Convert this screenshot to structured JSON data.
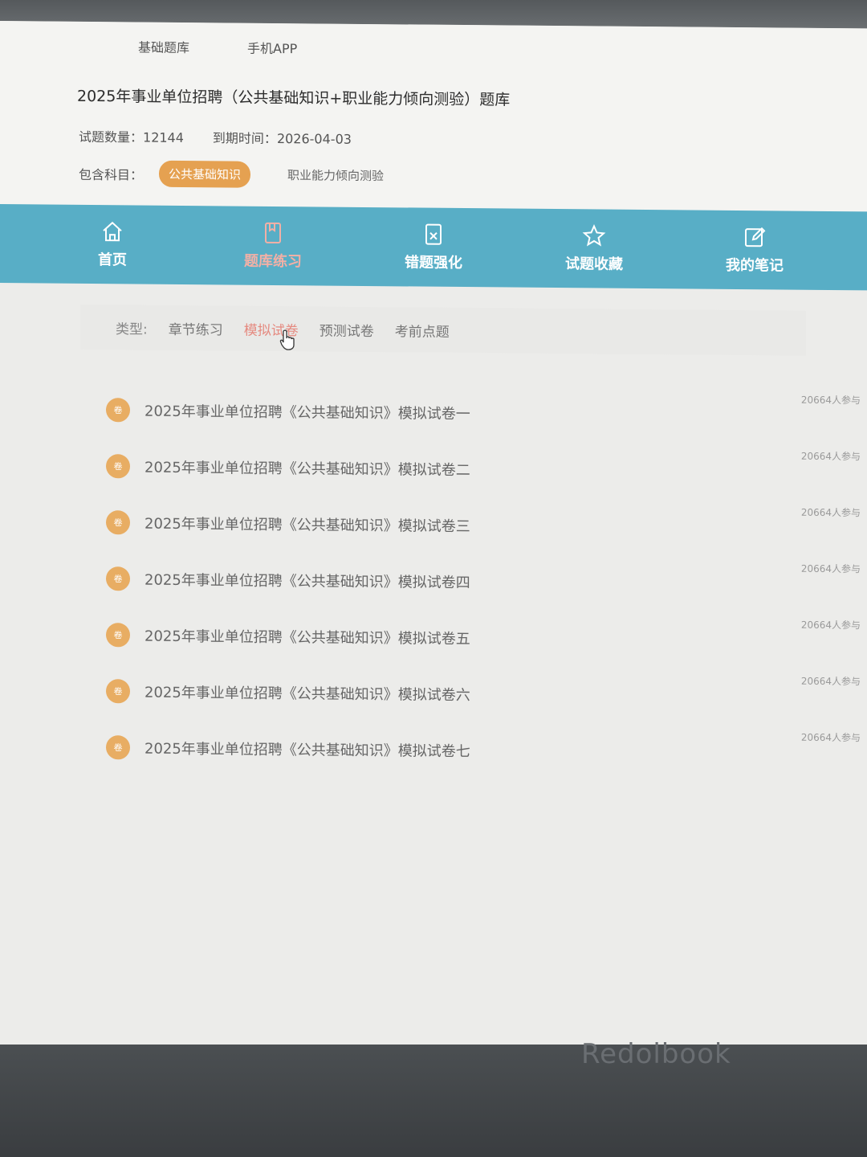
{
  "top_links": [
    "基础题库",
    "手机APP"
  ],
  "bank_title": "2025年事业单位招聘（公共基础知识+职业能力倾向测验）题库",
  "meta": {
    "count_label": "试题数量：",
    "count_value": "12144",
    "expiry_label": "到期时间：",
    "expiry_value": "2026-04-03"
  },
  "subjects": {
    "label": "包含科目：",
    "items": [
      "公共基础知识",
      "职业能力倾向测验"
    ]
  },
  "nav": [
    {
      "label": "首页",
      "icon": "home-icon"
    },
    {
      "label": "题库练习",
      "icon": "book-icon"
    },
    {
      "label": "错题强化",
      "icon": "wrong-doc-icon"
    },
    {
      "label": "试题收藏",
      "icon": "star-icon"
    },
    {
      "label": "我的笔记",
      "icon": "edit-icon"
    }
  ],
  "filter": {
    "label": "类型:",
    "options": [
      "章节练习",
      "模拟试卷",
      "预测试卷",
      "考前点题"
    ],
    "active": "模拟试卷"
  },
  "papers": [
    {
      "badge": "卷",
      "title": "2025年事业单位招聘《公共基础知识》模拟试卷一",
      "count": "20664人参与"
    },
    {
      "badge": "卷",
      "title": "2025年事业单位招聘《公共基础知识》模拟试卷二",
      "count": "20664人参与"
    },
    {
      "badge": "卷",
      "title": "2025年事业单位招聘《公共基础知识》模拟试卷三",
      "count": "20664人参与"
    },
    {
      "badge": "卷",
      "title": "2025年事业单位招聘《公共基础知识》模拟试卷四",
      "count": "20664人参与"
    },
    {
      "badge": "卷",
      "title": "2025年事业单位招聘《公共基础知识》模拟试卷五",
      "count": "20664人参与"
    },
    {
      "badge": "卷",
      "title": "2025年事业单位招聘《公共基础知识》模拟试卷六",
      "count": "20664人参与"
    },
    {
      "badge": "卷",
      "title": "2025年事业单位招聘《公共基础知识》模拟试卷七",
      "count": "20664人参与"
    }
  ],
  "brand": "Redolbook",
  "colors": {
    "nav_bg": "#58aec6",
    "accent_orange": "#e5a151",
    "active_red": "#e58a80"
  }
}
